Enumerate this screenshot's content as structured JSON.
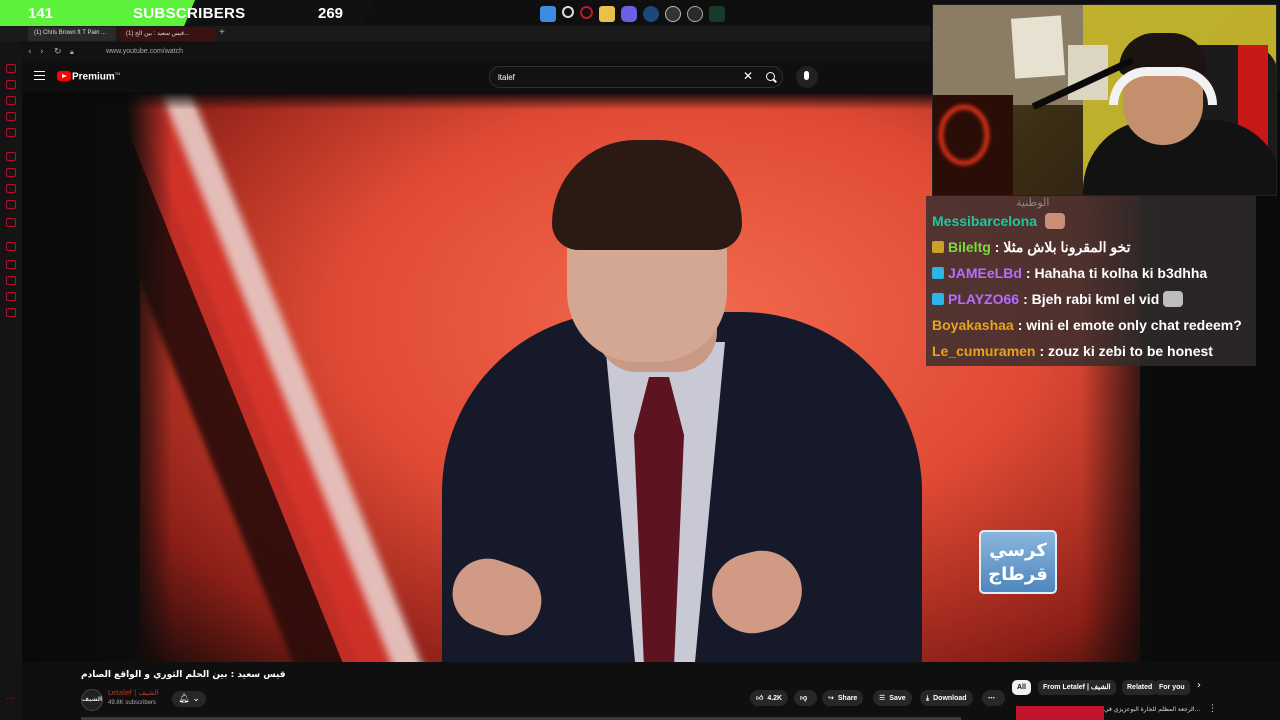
{
  "overlay": {
    "sub_goal": {
      "current": "141",
      "label": "SUBSCRIBERS",
      "goal": "269",
      "progress": 0.52
    }
  },
  "browser": {
    "tabs": [
      {
        "label": "(1) Chris Brown ft T Pain ..."
      },
      {
        "label": "(1) قيس سعيد : بين الح..."
      }
    ],
    "url": "www.youtube.com/watch"
  },
  "youtube": {
    "brand": "Premium",
    "brand_sup": "TN",
    "search_query": "ltalef",
    "video_title": "قيس سعيد : بين الحلم الثوري و الواقع الصادم",
    "channel": {
      "name": "Letalef | الشيف",
      "avatar_text": "الشيف",
      "subscribers": "49.8K subscribers"
    },
    "actions": {
      "likes": "4.2K",
      "share": "Share",
      "save": "Save",
      "download": "Download"
    },
    "chips": [
      "All",
      "From Letalef | الشيف",
      "Related",
      "For you"
    ],
    "recommended_title": "الرجعة المظلم للجارة البوعزيزي في...",
    "video_watermark": [
      "كرسي",
      "قرطاج"
    ]
  },
  "chat": {
    "header": "الوطنية",
    "messages": [
      {
        "user": "Messibarcelona",
        "user_color": "#1ec8a0",
        "text": "",
        "emote": true
      },
      {
        "user": "Bileltg",
        "user_color": "#7bdc3a",
        "text": "تخو المقرونا بلاش مثلا",
        "badge_color": "#c9a227"
      },
      {
        "user": "JAMEeLBd",
        "user_color": "#b56cff",
        "text": "Hahaha ti kolha ki b3dhha",
        "badge_color": "#2bb5e8"
      },
      {
        "user": "PLAYZO66",
        "user_color": "#b56cff",
        "text": "Bjeh rabi kml el vid",
        "badge_color": "#2bb5e8",
        "emote": true
      },
      {
        "user": "Boyakashaa",
        "user_color": "#e8a21e",
        "text": "wini el emote only chat redeem?"
      },
      {
        "user": "Le_cumuramen",
        "user_color": "#e8a21e",
        "text": "zouz ki zebi to be honest"
      }
    ]
  }
}
